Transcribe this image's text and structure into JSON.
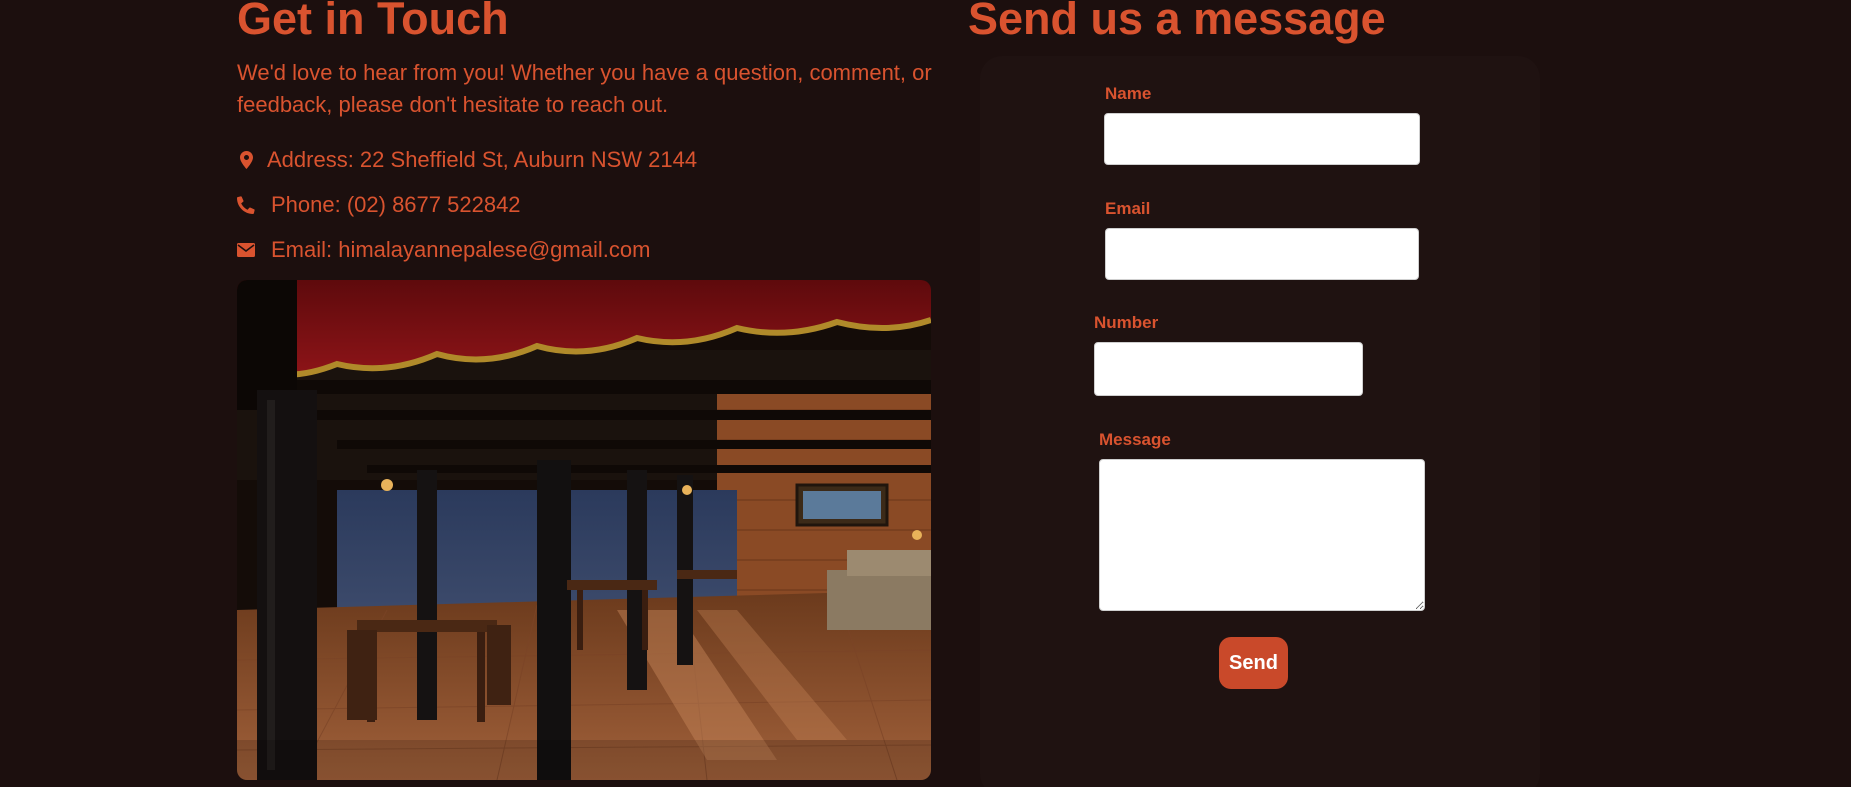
{
  "contact": {
    "heading": "Get in Touch",
    "intro": "We'd love to hear from you! Whether you have a question, comment, or feedback, please don't hesitate to reach out.",
    "address": "Address: 22 Sheffield St, Auburn NSW 2144",
    "phone": "Phone: (02) 8677 522842",
    "email": "Email: himalayannepalese@gmail.com",
    "icons": [
      "map-pin-icon",
      "phone-icon",
      "envelope-icon"
    ]
  },
  "form": {
    "heading": "Send us a message",
    "name_label": "Name",
    "email_label": "Email",
    "number_label": "Number",
    "message_label": "Message",
    "name_value": "",
    "email_value": "",
    "number_value": "",
    "message_value": "",
    "send_label": "Send"
  },
  "colors": {
    "background": "#1c0f0e",
    "card": "#1f1211",
    "accent": "#d9532f",
    "button": "#c9492a"
  }
}
